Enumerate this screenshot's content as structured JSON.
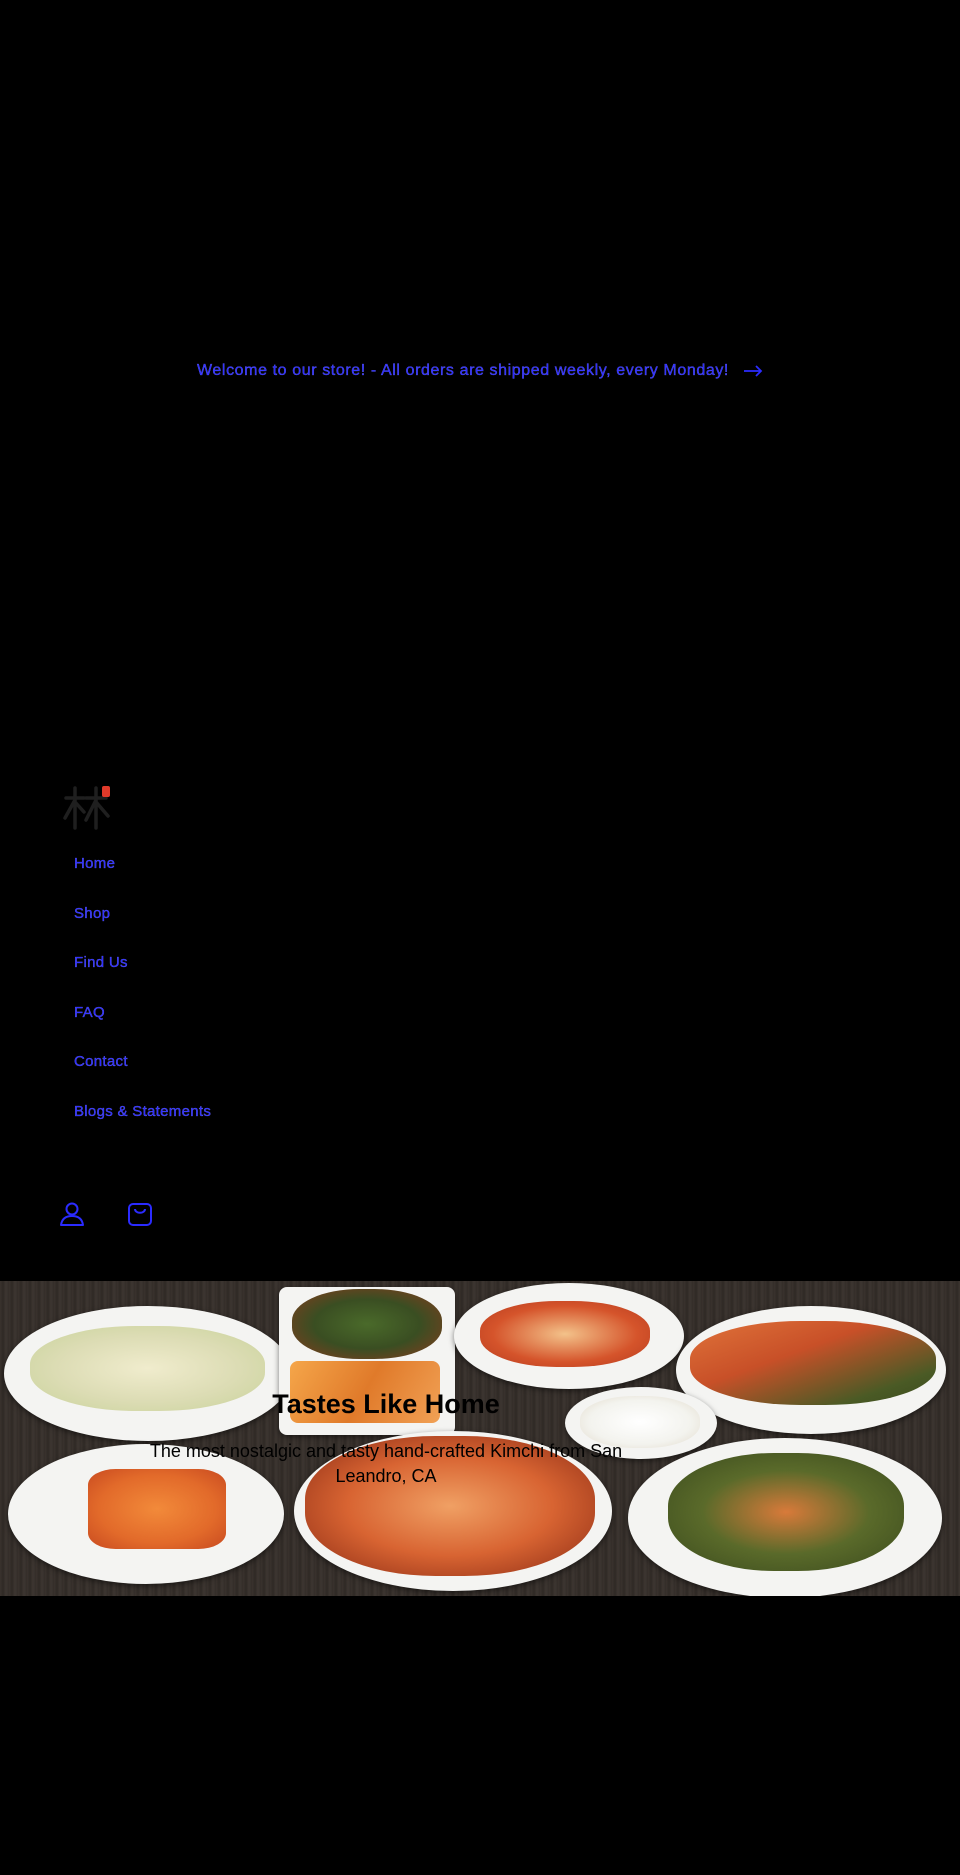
{
  "announcement": {
    "text": "Welcome to our store! - All orders are shipped weekly, every Monday!",
    "arrow_icon": "arrow-right-icon"
  },
  "header": {
    "logo_icon": "lim-kimchi-logo",
    "nav": [
      {
        "label": "Home"
      },
      {
        "label": "Shop"
      },
      {
        "label": "Find Us"
      },
      {
        "label": "FAQ"
      },
      {
        "label": "Contact"
      },
      {
        "label": "Blogs & Statements"
      }
    ],
    "icons": [
      "account-icon",
      "cart-icon"
    ]
  },
  "hero": {
    "title": "Tastes Like Home",
    "subtitle": "The most nostalgic and tasty hand-crafted Kimchi from San Leandro, CA"
  },
  "colors": {
    "background": "#000000",
    "link": "#2b2bff",
    "logo_accent": "#e03a2a"
  }
}
